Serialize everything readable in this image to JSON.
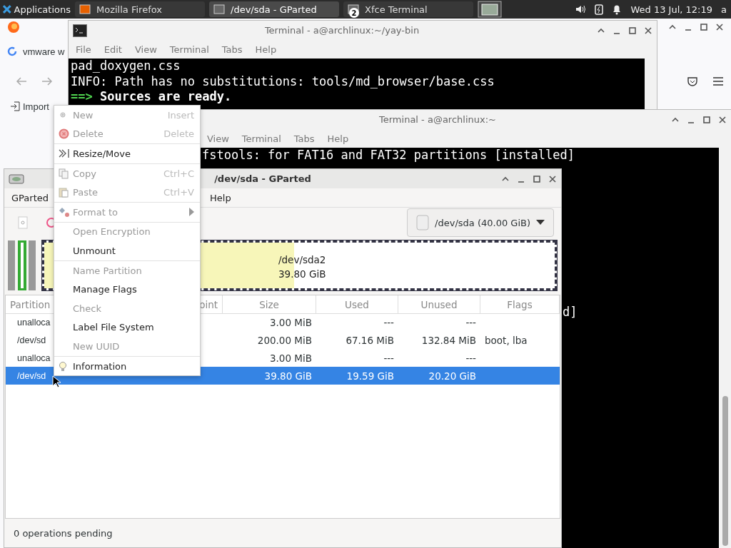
{
  "panel": {
    "launcher": "Applications",
    "tasks": [
      {
        "label": "Mozilla Firefox",
        "selected": false
      },
      {
        "label": "/dev/sda - GParted",
        "selected": true
      },
      {
        "label": "Xfce Terminal",
        "selected": false,
        "badge": "2"
      }
    ],
    "clock": "Wed 13 Jul, 12:19",
    "user": "a"
  },
  "browser": {
    "tab_title": "vmware w",
    "bookmark": "Import"
  },
  "terminal_back": {
    "title": "Terminal - a@archlinux:~/yay-bin",
    "menu": [
      "File",
      "Edit",
      "View",
      "Terminal",
      "Tabs",
      "Help"
    ],
    "lines": [
      {
        "kind": "plain",
        "text": "pad_doxygen.css"
      },
      {
        "kind": "plain",
        "text": "INFO: Path has no substitutions: tools/md_browser/base.css"
      },
      {
        "kind": "status",
        "marker": "==>",
        "text": "Sources are ready."
      }
    ]
  },
  "terminal_front": {
    "title": "Terminal - a@archlinux:~",
    "menu": [
      "View",
      "Terminal",
      "Tabs",
      "Help"
    ],
    "lines": [
      {
        "kind": "plain",
        "text": "fstools: for FAT16 and FAT32 partitions [installed]"
      },
      {
        "kind": "tail",
        "text": "d]"
      }
    ]
  },
  "gparted": {
    "title": "/dev/sda - GParted",
    "menu": [
      "GParted",
      "Help"
    ],
    "device": "/dev/sda (40.00 GiB)",
    "disk_map": {
      "label": "/dev/sda2",
      "size": "39.80 GiB",
      "level": 0.49
    },
    "columns": [
      "Partition",
      "oint",
      "Size",
      "Used",
      "Unused",
      "Flags"
    ],
    "rows": [
      {
        "partition": "unalloca",
        "size": "3.00 MiB",
        "used": "---",
        "unused": "---",
        "flags": "",
        "selected": false
      },
      {
        "partition": "/dev/sd",
        "size": "200.00 MiB",
        "used": "67.16 MiB",
        "unused": "132.84 MiB",
        "flags": "boot, lba",
        "selected": false
      },
      {
        "partition": "unalloca",
        "size": "3.00 MiB",
        "used": "---",
        "unused": "---",
        "flags": "",
        "selected": false
      },
      {
        "partition": "/dev/sd",
        "size": "39.80 GiB",
        "used": "19.59 GiB",
        "unused": "20.20 GiB",
        "flags": "",
        "selected": true
      }
    ],
    "status": "0 operations pending"
  },
  "context_menu": {
    "groups": [
      [
        {
          "label": "New",
          "shortcut": "Insert",
          "disabled": true
        },
        {
          "label": "Delete",
          "shortcut": "Delete",
          "disabled": true
        }
      ],
      [
        {
          "label": "Resize/Move",
          "disabled": false
        }
      ],
      [
        {
          "label": "Copy",
          "shortcut": "Ctrl+C",
          "disabled": true
        },
        {
          "label": "Paste",
          "shortcut": "Ctrl+V",
          "disabled": true
        }
      ],
      [
        {
          "label": "Format to",
          "disabled": true,
          "submenu": true
        }
      ],
      [
        {
          "label": "Open Encryption",
          "disabled": true
        },
        {
          "label": "Unmount",
          "disabled": false
        }
      ],
      [
        {
          "label": "Name Partition",
          "disabled": true
        },
        {
          "label": "Manage Flags",
          "disabled": false
        },
        {
          "label": "Check",
          "disabled": true
        },
        {
          "label": "Label File System",
          "disabled": false
        },
        {
          "label": "New UUID",
          "disabled": true
        }
      ],
      [
        {
          "label": "Information",
          "disabled": false
        }
      ]
    ]
  }
}
